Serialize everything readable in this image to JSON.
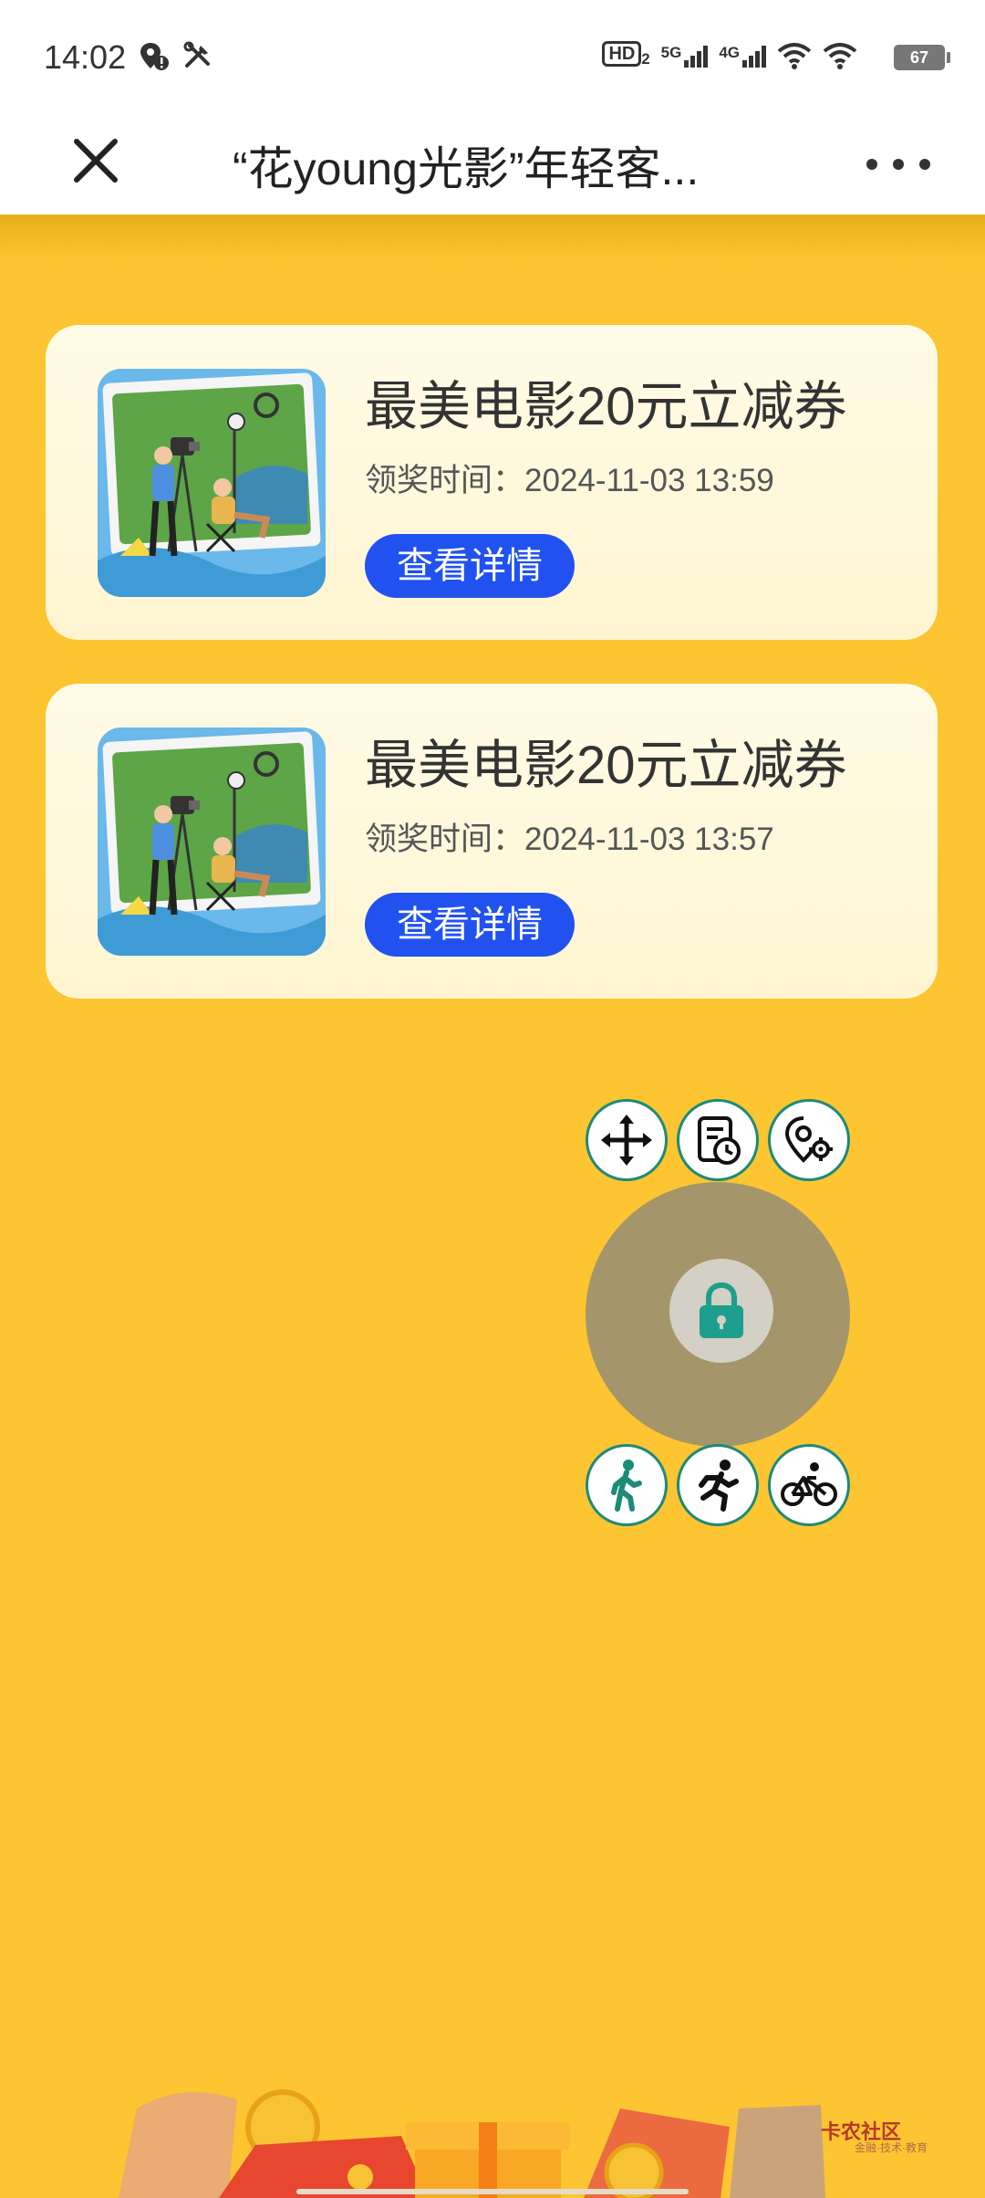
{
  "status_bar": {
    "time": "14:02",
    "hd_label": "HD",
    "hd_sub": "2",
    "net1": "5G",
    "net2": "4G",
    "battery": "67"
  },
  "header": {
    "title": "“花young光影”年轻客...",
    "close_icon": "close-icon",
    "more_icon": "more-icon"
  },
  "prizes": [
    {
      "title": "最美电影20元立减券",
      "time_label": "领奖时间：",
      "time": "2024-11-03 13:59",
      "button": "查看详情"
    },
    {
      "title": "最美电影20元立减券",
      "time_label": "领奖时间：",
      "time": "2024-11-03 13:57",
      "button": "查看详情"
    }
  ],
  "floating_controls": {
    "top": [
      "move-icon",
      "history-icon",
      "location-settings-icon"
    ],
    "center": "lock-icon",
    "bottom": [
      "walk-icon",
      "run-icon",
      "bike-icon"
    ]
  },
  "watermark": {
    "text": "卡农社区",
    "sub": "金融·技术·教育"
  },
  "colors": {
    "background": "#FCC531",
    "card": "#FFF8DC",
    "button": "#2152F0",
    "ctrl_border": "#1E8A78"
  }
}
